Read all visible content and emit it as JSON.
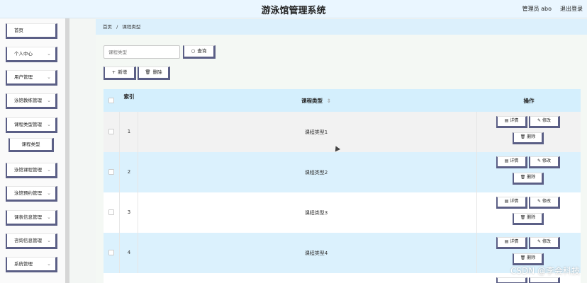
{
  "app": {
    "title": "游泳馆管理系统",
    "user_label": "管理员 abo",
    "logout_label": "退出登录"
  },
  "sidebar": {
    "items": [
      {
        "label": "首页",
        "has_chevron": false
      },
      {
        "label": "个人中心",
        "has_chevron": true
      },
      {
        "label": "用户管理",
        "has_chevron": true
      },
      {
        "label": "泳馆教练管理",
        "has_chevron": true
      },
      {
        "label": "课程类型管理",
        "has_chevron": true
      },
      {
        "label": "课程类型",
        "is_sub": true
      },
      {
        "label": "泳馆课程管理",
        "has_chevron": true
      },
      {
        "label": "泳馆预约管理",
        "has_chevron": true
      },
      {
        "label": "课表信息管理",
        "has_chevron": true
      },
      {
        "label": "咨询信息管理",
        "has_chevron": true
      },
      {
        "label": "系统管理",
        "has_chevron": true
      }
    ]
  },
  "breadcrumb": {
    "home": "首页",
    "separator": "/",
    "current": "课程类型"
  },
  "search": {
    "placeholder": "课程类型",
    "button_label": "查询"
  },
  "toolbar": {
    "add_label": "新增",
    "delete_label": "删除"
  },
  "table": {
    "headers": {
      "index": "索引",
      "type": "课程类型",
      "sort_icon": "⇕",
      "ops": "操作"
    },
    "rows": [
      {
        "index": "1",
        "type": "课程类型1"
      },
      {
        "index": "2",
        "type": "课程类型2"
      },
      {
        "index": "3",
        "type": "课程类型3"
      },
      {
        "index": "4",
        "type": "课程类型4"
      }
    ],
    "row_actions": {
      "detail": "详情",
      "edit": "修改",
      "delete": "删除"
    }
  },
  "watermark": "CSDN @李会科技",
  "colors": {
    "header_bg": "#eaf6ff",
    "accent_border": "#5b5f86",
    "row_highlight": "#d4effd",
    "breadcrumb_bg": "#dcf0fc"
  }
}
